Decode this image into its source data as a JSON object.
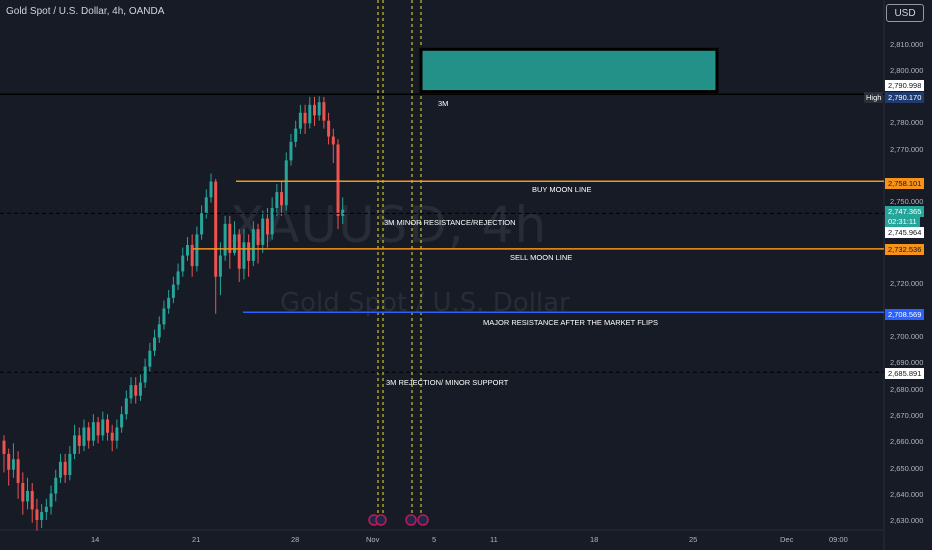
{
  "header": {
    "title": "Gold Spot / U.S. Dollar, 4h, OANDA",
    "currency": "USD"
  },
  "watermark": {
    "symbol": "XAUUSD, 4h",
    "name": "Gold Spot / U.S. Dollar"
  },
  "chart_data": {
    "type": "candlestick",
    "symbol": "XAUUSD",
    "interval": "4h",
    "source": "OANDA",
    "y_range": [
      2626,
      2822
    ],
    "y_ticks": [
      "2,810.000",
      "2,800.000",
      "2,790.000",
      "2,780.000",
      "2,770.000",
      "2,760.000",
      "2,750.000",
      "2,740.000",
      "2,730.000",
      "2,720.000",
      "2,710.000",
      "2,700.000",
      "2,690.000",
      "2,680.000",
      "2,670.000",
      "2,660.000",
      "2,650.000",
      "2,640.000",
      "2,630.000"
    ],
    "x_ticks": [
      "14",
      "21",
      "28",
      "Nov",
      "5",
      "11",
      "18",
      "25",
      "Dec",
      "09:00"
    ],
    "candles": [
      [
        2660.0,
        2655.0,
        2662.0,
        2648.0
      ],
      [
        2655.0,
        2649.0,
        2657.0,
        2643.0
      ],
      [
        2649.0,
        2653.0,
        2659.0,
        2646.0
      ],
      [
        2653.0,
        2644.0,
        2656.0,
        2638.0
      ],
      [
        2644.0,
        2637.0,
        2648.0,
        2632.0
      ],
      [
        2637.0,
        2641.0,
        2646.0,
        2634.0
      ],
      [
        2641.0,
        2634.0,
        2644.0,
        2629.0
      ],
      [
        2634.0,
        2630.0,
        2638.0,
        2626.0
      ],
      [
        2630.0,
        2633.0,
        2636.0,
        2627.0
      ],
      [
        2633.0,
        2635.0,
        2638.0,
        2630.0
      ],
      [
        2635.0,
        2640.0,
        2643.0,
        2632.0
      ],
      [
        2640.0,
        2646.0,
        2649.0,
        2637.0
      ],
      [
        2646.0,
        2652.0,
        2655.0,
        2644.0
      ],
      [
        2652.0,
        2647.0,
        2655.0,
        2644.0
      ],
      [
        2647.0,
        2655.0,
        2658.0,
        2645.0
      ],
      [
        2655.0,
        2662.0,
        2666.0,
        2653.0
      ],
      [
        2662.0,
        2658.0,
        2665.0,
        2655.0
      ],
      [
        2658.0,
        2665.0,
        2668.0,
        2656.0
      ],
      [
        2665.0,
        2660.0,
        2667.0,
        2657.0
      ],
      [
        2660.0,
        2667.0,
        2670.0,
        2658.0
      ],
      [
        2667.0,
        2662.0,
        2669.0,
        2659.0
      ],
      [
        2662.0,
        2668.0,
        2671.0,
        2660.0
      ],
      [
        2668.0,
        2663.0,
        2670.0,
        2660.0
      ],
      [
        2663.0,
        2660.0,
        2666.0,
        2656.0
      ],
      [
        2660.0,
        2665.0,
        2668.0,
        2657.0
      ],
      [
        2665.0,
        2670.0,
        2673.0,
        2663.0
      ],
      [
        2670.0,
        2676.0,
        2679.0,
        2668.0
      ],
      [
        2676.0,
        2681.0,
        2684.0,
        2674.0
      ],
      [
        2681.0,
        2677.0,
        2684.0,
        2674.0
      ],
      [
        2677.0,
        2682.0,
        2685.0,
        2675.0
      ],
      [
        2682.0,
        2688.0,
        2691.0,
        2680.0
      ],
      [
        2688.0,
        2694.0,
        2697.0,
        2686.0
      ],
      [
        2694.0,
        2699.0,
        2702.0,
        2692.0
      ],
      [
        2699.0,
        2704.0,
        2707.0,
        2697.0
      ],
      [
        2704.0,
        2710.0,
        2713.0,
        2702.0
      ],
      [
        2710.0,
        2714.0,
        2717.0,
        2708.0
      ],
      [
        2714.0,
        2719.0,
        2722.0,
        2712.0
      ],
      [
        2719.0,
        2724.0,
        2727.0,
        2717.0
      ],
      [
        2724.0,
        2730.0,
        2733.0,
        2722.0
      ],
      [
        2730.0,
        2734.0,
        2737.0,
        2728.0
      ],
      [
        2734.0,
        2726.0,
        2738.0,
        2722.0
      ],
      [
        2726.0,
        2738.0,
        2741.0,
        2724.0
      ],
      [
        2738.0,
        2746.0,
        2749.0,
        2736.0
      ],
      [
        2746.0,
        2752.0,
        2755.0,
        2744.0
      ],
      [
        2752.0,
        2758.0,
        2761.0,
        2750.0
      ],
      [
        2758.0,
        2722.0,
        2759.0,
        2708.0
      ],
      [
        2722.0,
        2730.0,
        2735.0,
        2715.0
      ],
      [
        2730.0,
        2742.0,
        2745.0,
        2728.0
      ],
      [
        2742.0,
        2731.0,
        2745.0,
        2725.0
      ],
      [
        2731.0,
        2738.0,
        2743.0,
        2730.0
      ],
      [
        2738.0,
        2725.0,
        2740.0,
        2720.0
      ],
      [
        2725.0,
        2735.0,
        2740.0,
        2721.0
      ],
      [
        2735.0,
        2728.0,
        2738.0,
        2722.0
      ],
      [
        2728.0,
        2740.0,
        2743.0,
        2726.0
      ],
      [
        2740.0,
        2734.0,
        2742.0,
        2727.0
      ],
      [
        2734.0,
        2744.0,
        2747.0,
        2731.0
      ],
      [
        2744.0,
        2738.0,
        2748.0,
        2733.0
      ],
      [
        2738.0,
        2748.0,
        2752.0,
        2736.0
      ],
      [
        2748.0,
        2754.0,
        2757.0,
        2745.0
      ],
      [
        2754.0,
        2749.0,
        2758.0,
        2745.0
      ],
      [
        2749.0,
        2766.0,
        2769.0,
        2747.0
      ],
      [
        2766.0,
        2773.0,
        2776.0,
        2764.0
      ],
      [
        2773.0,
        2778.0,
        2781.0,
        2771.0
      ],
      [
        2778.0,
        2784.0,
        2787.0,
        2776.0
      ],
      [
        2784.0,
        2780.0,
        2787.0,
        2776.0
      ],
      [
        2780.0,
        2787.0,
        2790.0,
        2778.0
      ],
      [
        2787.0,
        2783.0,
        2790.0,
        2779.0
      ],
      [
        2783.0,
        2788.0,
        2790.2,
        2781.0
      ],
      [
        2788.0,
        2781.0,
        2790.0,
        2778.0
      ],
      [
        2781.0,
        2775.0,
        2784.0,
        2772.0
      ],
      [
        2775.0,
        2772.0,
        2778.0,
        2765.0
      ],
      [
        2772.0,
        2745.0,
        2774.0,
        2740.0
      ],
      [
        2745.0,
        2747.365,
        2752.0,
        2742.0
      ]
    ],
    "levels": [
      {
        "label": "BUY MOON LINE",
        "price_label": "2,758.101",
        "value": 2758.101,
        "color": "#f7931a",
        "style": "solid"
      },
      {
        "label": "3M MINOR RESISTANCE/REJECTION",
        "price_label": "2,745.964",
        "value": 2745.964,
        "color": "#000000",
        "style": "dashed"
      },
      {
        "label": "SELL MOON LINE",
        "price_label": "2,732.536",
        "value": 2732.536,
        "color": "#f7931a",
        "style": "solid"
      },
      {
        "label": "MAJOR RESISTANCE AFTER THE MARKET FLIPS",
        "price_label": "2,708.569",
        "value": 2708.569,
        "color": "#2962ff",
        "style": "solid"
      },
      {
        "label": "3M REJECTION/ MINOR SUPPORT",
        "price_label": "2,685.891",
        "value": 2685.891,
        "color": "#000000",
        "style": "dashed"
      }
    ],
    "horizontal_line": {
      "price_label": "2,790.998",
      "value": 2790.998
    },
    "high": {
      "label": "High",
      "price_label": "2,790.170",
      "value": 2790.17
    },
    "current_price": {
      "price_label": "2,747.365",
      "countdown": "02:31:11",
      "value": 2747.365
    },
    "zone": {
      "label": "3M",
      "top": 2808.0,
      "bottom": 2792.0,
      "color": "#26a69a"
    },
    "colors": {
      "up": "#26a69a",
      "down": "#ef5350",
      "background": "#171b26"
    }
  }
}
